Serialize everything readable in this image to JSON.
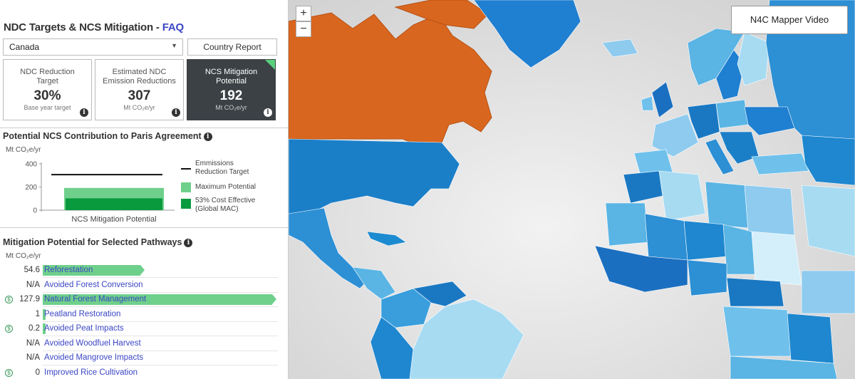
{
  "header": {
    "title": "NDC Targets & NCS Mitigation - ",
    "faq_link": "FAQ"
  },
  "controls": {
    "country_selected": "Canada",
    "report_button": "Country Report"
  },
  "cards": [
    {
      "label_line1": "NDC Reduction",
      "label_line2": "Target",
      "value": "30%",
      "unit": "Base year target"
    },
    {
      "label_line1": "Estimated NDC",
      "label_line2": "Emission Reductions",
      "value": "307",
      "unit": "Mt CO₂e/yr"
    },
    {
      "label_line1": "NCS Mitigation",
      "label_line2": "Potential",
      "value": "192",
      "unit": "Mt CO₂e/yr"
    }
  ],
  "contribution": {
    "title": "Potential NCS Contribution to Paris Agreement",
    "unit": "Mt CO₂e/yr",
    "legend": {
      "target_line1": "Emmissions",
      "target_line2": "Reduction Target",
      "max": "Maximum Potential",
      "cost_line1": "53% Cost Effective",
      "cost_line2": "(Global MAC)"
    },
    "colors": {
      "target": "#111111",
      "max": "#6fd08b",
      "cost": "#0a9a3e"
    }
  },
  "chart_data": {
    "type": "bar",
    "categories": [
      "NCS Mitigation Potential"
    ],
    "series": [
      {
        "name": "Maximum Potential",
        "values": [
          192
        ]
      },
      {
        "name": "53% Cost Effective (Global MAC)",
        "values": [
          102
        ]
      }
    ],
    "reference_line": {
      "name": "Emmissions Reduction Target",
      "value": 307
    },
    "ylabel": "Mt CO₂e/yr",
    "yticks": [
      0,
      200,
      400
    ],
    "ylim": [
      0,
      400
    ]
  },
  "pathways": {
    "title": "Mitigation Potential for Selected Pathways",
    "unit": "Mt CO₂e/yr",
    "max_scale": 127.9,
    "rows": [
      {
        "value": "54.6",
        "name": "Reforestation",
        "dollar": false,
        "amount": 54.6
      },
      {
        "value": "N/A",
        "name": "Avoided Forest Conversion",
        "dollar": false,
        "amount": 0
      },
      {
        "value": "127.9",
        "name": "Natural Forest Management",
        "dollar": true,
        "amount": 127.9
      },
      {
        "value": "1",
        "name": "Peatland Restoration",
        "dollar": false,
        "amount": 1
      },
      {
        "value": "0.2",
        "name": "Avoided Peat Impacts",
        "dollar": true,
        "amount": 0.2
      },
      {
        "value": "N/A",
        "name": "Avoided Woodfuel Harvest",
        "dollar": false,
        "amount": 0
      },
      {
        "value": "N/A",
        "name": "Avoided Mangrove Impacts",
        "dollar": false,
        "amount": 0
      },
      {
        "value": "0",
        "name": "Improved Rice Cultivation",
        "dollar": true,
        "amount": 0
      }
    ]
  },
  "map": {
    "zoom_in": "+",
    "zoom_out": "−",
    "video_button": "N4C Mapper Video",
    "selected_color": "#d9661f",
    "ocean_color": "#dcdcdc"
  }
}
